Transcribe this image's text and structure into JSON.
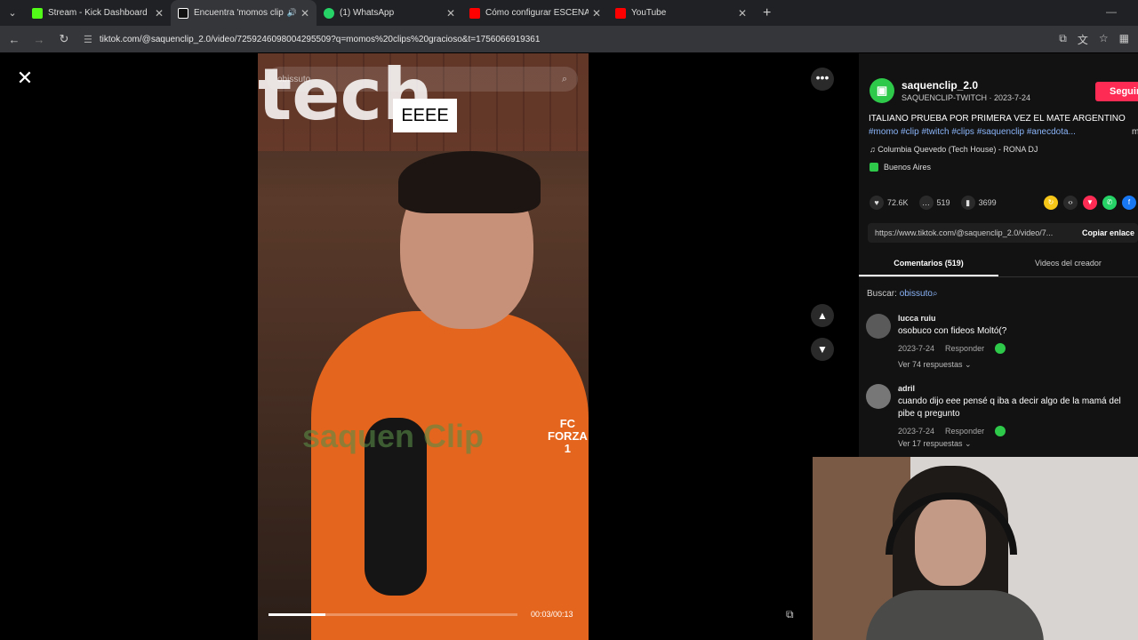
{
  "browser": {
    "tabs": [
      {
        "title": "Stream - Kick Dashboard",
        "fav_color": "#53fc18"
      },
      {
        "title": "Encuentra 'momos clips gr...",
        "fav_color": "#111111",
        "active": true
      },
      {
        "title": "(1) WhatsApp",
        "fav_color": "#25d366"
      },
      {
        "title": "Cómo configurar ESCENAS y F...",
        "fav_color": "#ff0000"
      },
      {
        "title": "YouTube",
        "fav_color": "#ff0000"
      }
    ],
    "url": "tiktok.com/@saquenclip_2.0/video/7259246098004295509?q=momos%20clips%20gracioso&t=1756066919361"
  },
  "video": {
    "search_placeholder": "obissuto",
    "caption": "EEEE",
    "timecode": "00:03/00:13",
    "progress": 0.23,
    "wall_text": "tech",
    "watermark": "saquen Clip",
    "jersey": [
      "FC",
      "FORZA",
      "1"
    ]
  },
  "post": {
    "username": "saquenclip_2.0",
    "meta": "SAQUENCLIP-TWITCH · 2023-7-24",
    "follow_label": "Seguir",
    "description": "ITALIANO PRUEBA POR PRIMERA VEZ EL MATE ARGENTINO",
    "hashtags": "#momo #clip #twitch #clips #saquenclip #anecdota...",
    "more_label": "m",
    "music": "♫  Columbia Quevedo (Tech House) - RONA DJ",
    "location": "Buenos Aires",
    "likes": "72.6K",
    "comments_count": "519",
    "saves": "3699",
    "link": "https://www.tiktok.com/@saquenclip_2.0/video/7...",
    "copy_label": "Copiar enlace",
    "tab_comments": "Comentarios (519)",
    "tab_creator": "Videos del creador",
    "search_label": "Buscar:",
    "search_query": "obissuto"
  },
  "comments": [
    {
      "name": "lucca ruiu",
      "text": "osobuco con fideos Moltó(?",
      "date": "2023-7-24",
      "reply": "Responder",
      "replies": "Ver 74 respuestas ⌄"
    },
    {
      "name": "adril",
      "text": "cuando dijo eee pensé q iba a decir algo de la mamá del pibe q pregunto",
      "date": "2023-7-24",
      "reply": "Responder",
      "replies": "Ver 17 respuestas ⌄"
    }
  ],
  "icons": {
    "close": "close-icon",
    "more": "more-icon",
    "up": "chevron-up-icon",
    "down": "chevron-down-icon"
  }
}
